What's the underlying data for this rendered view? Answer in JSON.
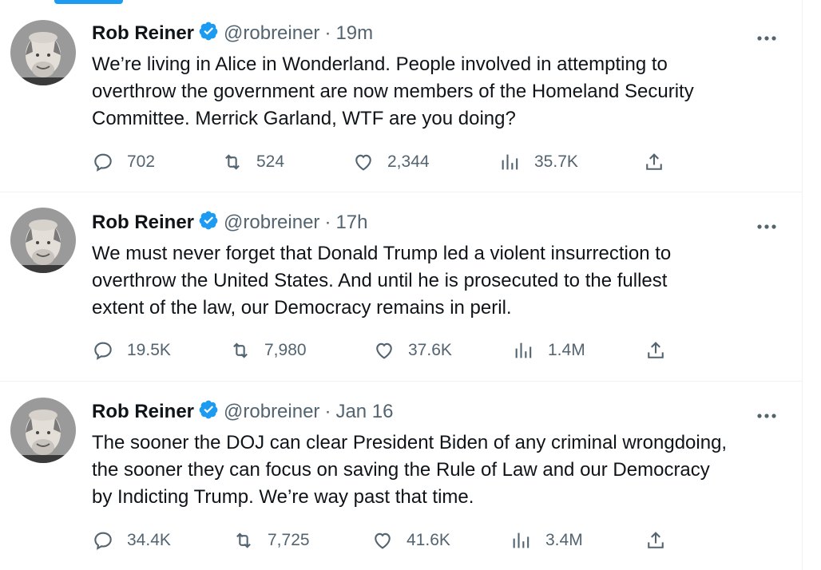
{
  "tweets": [
    {
      "author": {
        "name": "Rob Reiner",
        "handle": "@robreiner"
      },
      "time": "19m",
      "text": "We’re living in Alice in Wonderland. People involved in attempting to overthrow the government are now members of the Homeland Security Committee. Merrick Garland, WTF are you doing?",
      "lines": [
        "We’re living in Alice in Wonderland. People involved in attempting to",
        "overthrow the government are now members of the Homeland Security",
        "Committee. Merrick Garland, WTF are you doing?"
      ],
      "stats": {
        "replies": "702",
        "retweets": "524",
        "likes": "2,344",
        "views": "35.7K"
      }
    },
    {
      "author": {
        "name": "Rob Reiner",
        "handle": "@robreiner"
      },
      "time": "17h",
      "text": "We must never forget that Donald Trump led a violent insurrection to overthrow the United States. And until he is prosecuted to the fullest extent of the law, our Democracy remains in peril.",
      "lines": [
        "We must never forget that Donald Trump led a violent insurrection to",
        "overthrow the United States. And until he is prosecuted to the fullest",
        "extent of the law, our Democracy remains in peril."
      ],
      "stats": {
        "replies": "19.5K",
        "retweets": "7,980",
        "likes": "37.6K",
        "views": "1.4M"
      }
    },
    {
      "author": {
        "name": "Rob Reiner",
        "handle": "@robreiner"
      },
      "time": "Jan 16",
      "text": "The sooner the DOJ can clear President Biden of any criminal wrongdoing, the sooner they can focus on saving the Rule of Law and our Democracy by Indicting Trump. We’re way past that time.",
      "lines": [
        "The sooner the DOJ can clear President Biden of any criminal wrongdoing,",
        "the sooner they can focus on saving the Rule of Law and our Democracy",
        "by Indicting Trump. We’re way past that time."
      ],
      "stats": {
        "replies": "34.4K",
        "retweets": "7,725",
        "likes": "41.6K",
        "views": "3.4M"
      }
    }
  ],
  "separator": "·",
  "icons": {
    "verified": "verified-badge-icon",
    "more": "more-options-icon",
    "reply": "reply-icon",
    "retweet": "retweet-icon",
    "like": "like-icon",
    "views": "views-icon",
    "share": "share-icon"
  },
  "colors": {
    "accent": "#1d9bf0",
    "text": "#0f1419",
    "secondary": "#536471",
    "border": "#eff3f4"
  }
}
